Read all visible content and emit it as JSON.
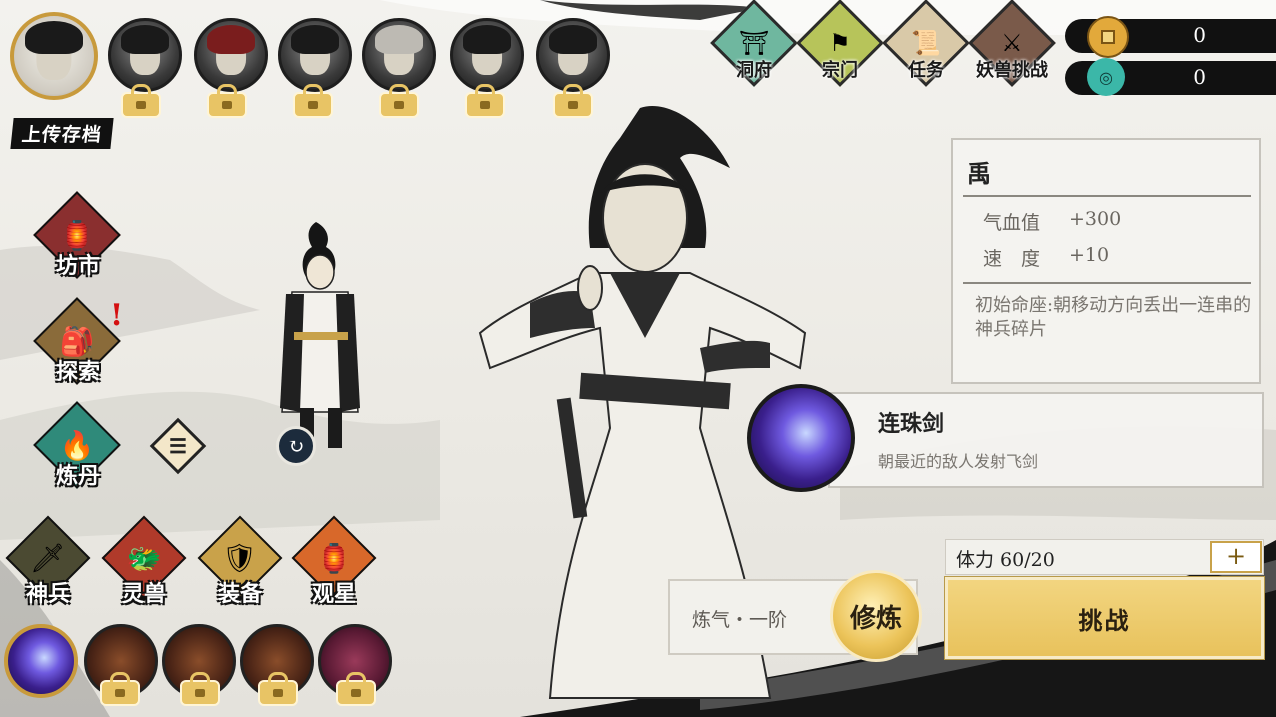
{
  "header": {
    "save_label": "上传存档",
    "roster": [
      {
        "state": "active"
      },
      {
        "state": "locked"
      },
      {
        "state": "locked"
      },
      {
        "state": "locked"
      },
      {
        "state": "locked"
      },
      {
        "state": "locked"
      },
      {
        "state": "locked"
      }
    ]
  },
  "top_menu": {
    "cave": "洞府",
    "sect": "宗门",
    "quest": "任务",
    "beast_challenge": "妖兽挑战"
  },
  "currency": {
    "gold": "0",
    "jade": "0",
    "gold_color": "#e2a93b",
    "jade_color": "#3bb7a8"
  },
  "character": {
    "name": "禹",
    "stats": [
      {
        "label": "气血值",
        "value": "+300"
      },
      {
        "label": "速　度",
        "value": "+10"
      }
    ],
    "constellation": "初始命座:朝移动方向丢出一连串的神兵碎片"
  },
  "skill": {
    "name": "连珠剑",
    "desc": "朝最近的敌人发射飞剑"
  },
  "side_menu": {
    "market": "坊市",
    "explore": "探索",
    "alchemy": "炼丹"
  },
  "bottom_menu": {
    "weapon": "神兵",
    "beast": "灵兽",
    "equip": "装备",
    "stars": "观星"
  },
  "cultivation": {
    "level": "炼气・一阶",
    "button": "修炼"
  },
  "stamina": {
    "label": "体力 60/20",
    "plus": "+"
  },
  "challenge": {
    "button": "挑战"
  },
  "colors": {
    "accent_gold": "#e8c25c",
    "ink": "#111111",
    "panel": "#f4f3f0"
  }
}
